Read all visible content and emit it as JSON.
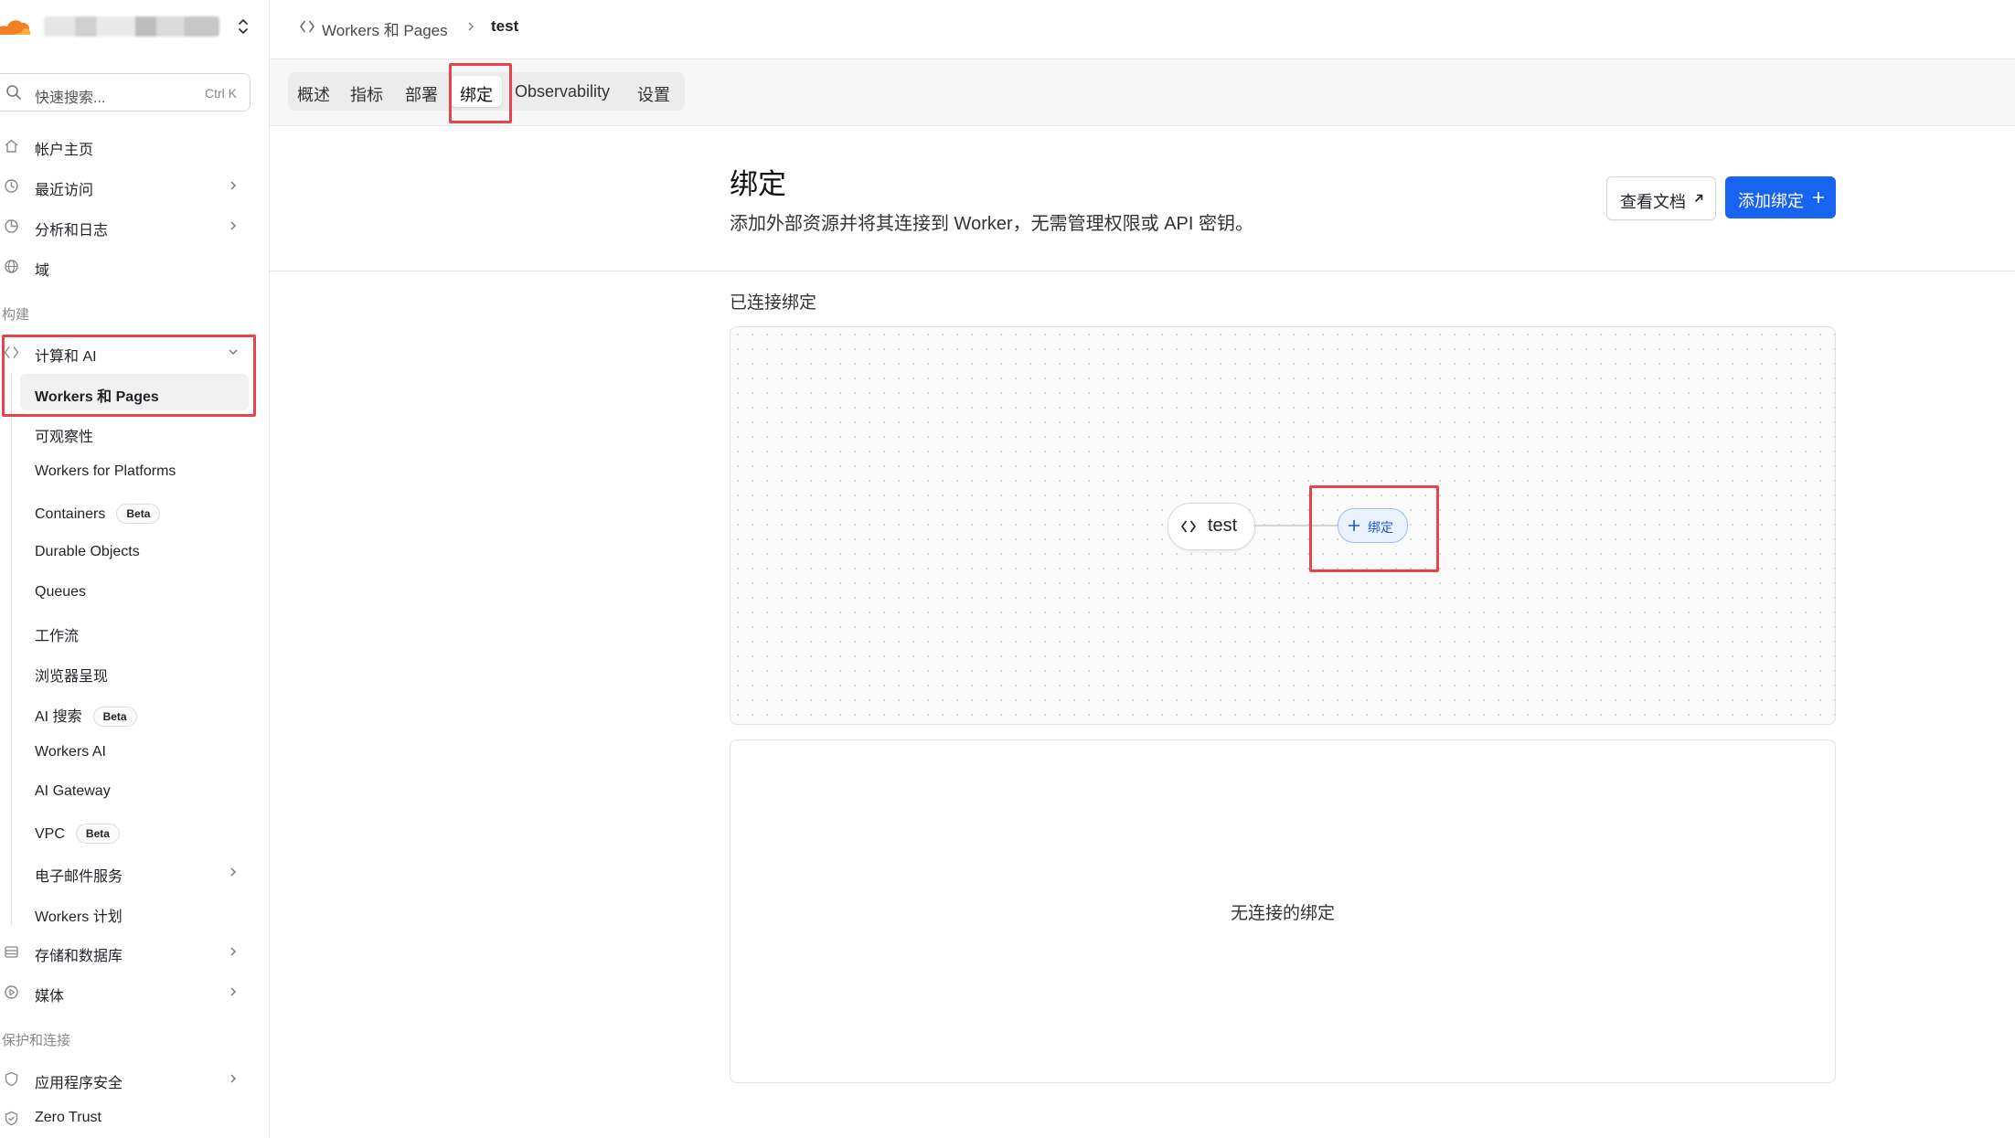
{
  "sidebar": {
    "search": {
      "placeholder": "快速搜索...",
      "shortcut": "Ctrl K"
    },
    "items": [
      {
        "label": "帐户主页"
      },
      {
        "label": "最近访问"
      },
      {
        "label": "分析和日志"
      },
      {
        "label": "域"
      }
    ],
    "section_build": "构建",
    "compute": {
      "label": "计算和 AI",
      "children": [
        {
          "label": "Workers 和 Pages"
        },
        {
          "label": "可观察性"
        },
        {
          "label": "Workers for Platforms"
        },
        {
          "label": "Containers",
          "badge": "Beta"
        },
        {
          "label": "Durable Objects"
        },
        {
          "label": "Queues"
        },
        {
          "label": "工作流"
        },
        {
          "label": "浏览器呈现"
        },
        {
          "label": "AI 搜索",
          "badge": "Beta"
        },
        {
          "label": "Workers AI"
        },
        {
          "label": "AI Gateway"
        },
        {
          "label": "VPC",
          "badge": "Beta"
        },
        {
          "label": "电子邮件服务"
        },
        {
          "label": "Workers 计划"
        }
      ]
    },
    "storage": {
      "label": "存储和数据库"
    },
    "media": {
      "label": "媒体"
    },
    "section_protect": "保护和连接",
    "appsec": {
      "label": "应用程序安全"
    },
    "zerotrust": {
      "label": "Zero Trust"
    }
  },
  "breadcrumb": {
    "parent": "Workers 和 Pages",
    "current": "test"
  },
  "tabs": [
    "概述",
    "指标",
    "部署",
    "绑定",
    "Observability",
    "设置"
  ],
  "header": {
    "title": "绑定",
    "subtitle": "添加外部资源并将其连接到 Worker，无需管理权限或 API 密钥。",
    "docs_button": "查看文档",
    "add_button": "添加绑定"
  },
  "connected": {
    "title": "已连接绑定",
    "worker_node": "test",
    "bind_node": "绑定",
    "empty_text": "无连接的绑定"
  },
  "colors": {
    "accent": "#1763f2",
    "highlight": "#e4444c",
    "brand": "#f38020"
  },
  "icons": {
    "logo": "cloudflare-logo",
    "account_switch": "chevron-up-down-icon",
    "search": "search-icon",
    "home": "home-icon",
    "recent": "clock-icon",
    "analytics": "chart-pie-icon",
    "domain": "globe-icon",
    "compute": "code-diamond-icon",
    "storage": "database-icon",
    "media": "play-circle-icon",
    "appsec": "shield-icon",
    "zerotrust": "shield-check-icon"
  }
}
